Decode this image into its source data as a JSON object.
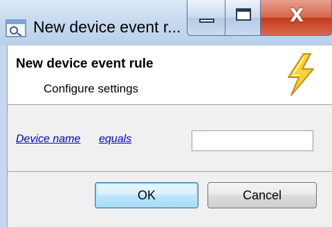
{
  "window": {
    "title": "New device event r...",
    "controls": {
      "minimize_icon": "minimize-icon",
      "maximize_icon": "maximize-icon",
      "close_glyph": "X"
    }
  },
  "header": {
    "title": "New device event rule",
    "subtitle": "Configure settings",
    "icon": "lightning-bolt-icon"
  },
  "rule": {
    "field_link": "Device name",
    "operator_link": "equals",
    "value": "",
    "placeholder": ""
  },
  "buttons": {
    "ok_label": "OK",
    "cancel_label": "Cancel"
  },
  "colors": {
    "link": "#0000cc",
    "title_bar": "#c8daf0",
    "close_button": "#c4391c",
    "bolt_fill": "#f7d23a"
  }
}
